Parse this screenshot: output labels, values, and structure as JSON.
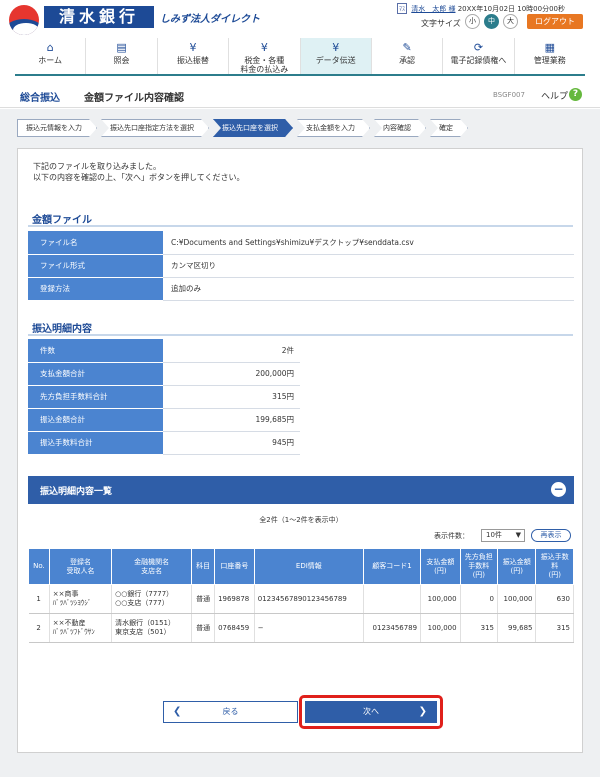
{
  "bank": {
    "name": "清水銀行",
    "sub": "しみず法人ダイレクト"
  },
  "user": {
    "badge": "ﾏｽ",
    "name": "清水　太郎 様",
    "datetime": "20XX年10月02日 10時00分00秒"
  },
  "font_size": {
    "label": "文字サイズ",
    "small": "小",
    "medium": "中",
    "large": "大"
  },
  "logout": "ログアウト",
  "nav": [
    {
      "label": "ホーム",
      "icon": "home-icon",
      "glyph": "⌂"
    },
    {
      "label": "照会",
      "icon": "document-icon",
      "glyph": "▤"
    },
    {
      "label": "振込振替",
      "icon": "yen-transfer-icon",
      "glyph": "¥"
    },
    {
      "label": "税金・各種\n料金の払込み",
      "icon": "yen-tax-icon",
      "glyph": "¥"
    },
    {
      "label": "データ伝送",
      "icon": "yen-data-icon",
      "glyph": "¥"
    },
    {
      "label": "承認",
      "icon": "approval-icon",
      "glyph": "✎"
    },
    {
      "label": "電子記録債権へ",
      "icon": "e-claims-icon",
      "glyph": "⟳"
    },
    {
      "label": "管理業務",
      "icon": "admin-icon",
      "glyph": "▦"
    }
  ],
  "page": {
    "category": "総合振込",
    "title": "金額ファイル内容確認",
    "code": "BSGF007",
    "help": "ヘルプ",
    "help_icon": "?"
  },
  "steps": [
    "振込元情報を入力",
    "振込先口座指定方法を選択",
    "振込先口座を選択",
    "支払金額を入力",
    "内容確認",
    "確定"
  ],
  "intro": [
    "下記のファイルを取り込みました。",
    "以下の内容を確認の上、「次へ」ボタンを押してください。"
  ],
  "file_section": {
    "title": "金額ファイル",
    "rows": [
      {
        "label": "ファイル名",
        "value": "C:¥Documents and Settings¥shimizu¥デスクトップ¥senddata.csv"
      },
      {
        "label": "ファイル形式",
        "value": "カンマ区切り"
      },
      {
        "label": "登録方法",
        "value": "追加のみ"
      }
    ]
  },
  "detail_section": {
    "title": "振込明細内容",
    "rows": [
      {
        "label": "件数",
        "value": "2件"
      },
      {
        "label": "支払金額合計",
        "value": "200,000円"
      },
      {
        "label": "先方負担手数料合計",
        "value": "315円"
      },
      {
        "label": "振込金額合計",
        "value": "199,685円"
      },
      {
        "label": "振込手数料合計",
        "value": "945円"
      }
    ]
  },
  "list": {
    "title": "振込明細内容一覧",
    "toggle": "−",
    "count": "全2件（1～2件を表示中）",
    "display_count_label": "表示件数：",
    "display_count_value": "10件",
    "redisplay": "再表示",
    "headers": [
      "No.",
      "登録名\n受取人名",
      "金融機関名\n支店名",
      "科目",
      "口座番号",
      "EDI情報",
      "顧客コード1",
      "支払金額\n(円)",
      "先方負担\n手数料\n(円)",
      "振込金額\n(円)",
      "振込手数\n料\n(円)"
    ],
    "rows": [
      {
        "no": "1",
        "name": "××商事\nﾊﾞﾂﾊﾞﾂｼﾖｳｼﾞ",
        "bank": "○○銀行（7777）\n○○支店（777）",
        "type": "普通",
        "account": "1969878",
        "edi": "01234567890123456789",
        "customer": "",
        "payment": "100,000",
        "fee_borne": "0",
        "transfer": "100,000",
        "transfer_fee": "630"
      },
      {
        "no": "2",
        "name": "××不動産\nﾊﾞﾂﾊﾞﾂﾌﾄﾞｳｻﾝ",
        "bank": "清水銀行（0151）\n東京支店（501）",
        "type": "普通",
        "account": "0768459",
        "edi": "−",
        "customer": "0123456789",
        "payment": "100,000",
        "fee_borne": "315",
        "transfer": "99,685",
        "transfer_fee": "315"
      }
    ]
  },
  "buttons": {
    "back": "戻る",
    "next": "次へ"
  }
}
